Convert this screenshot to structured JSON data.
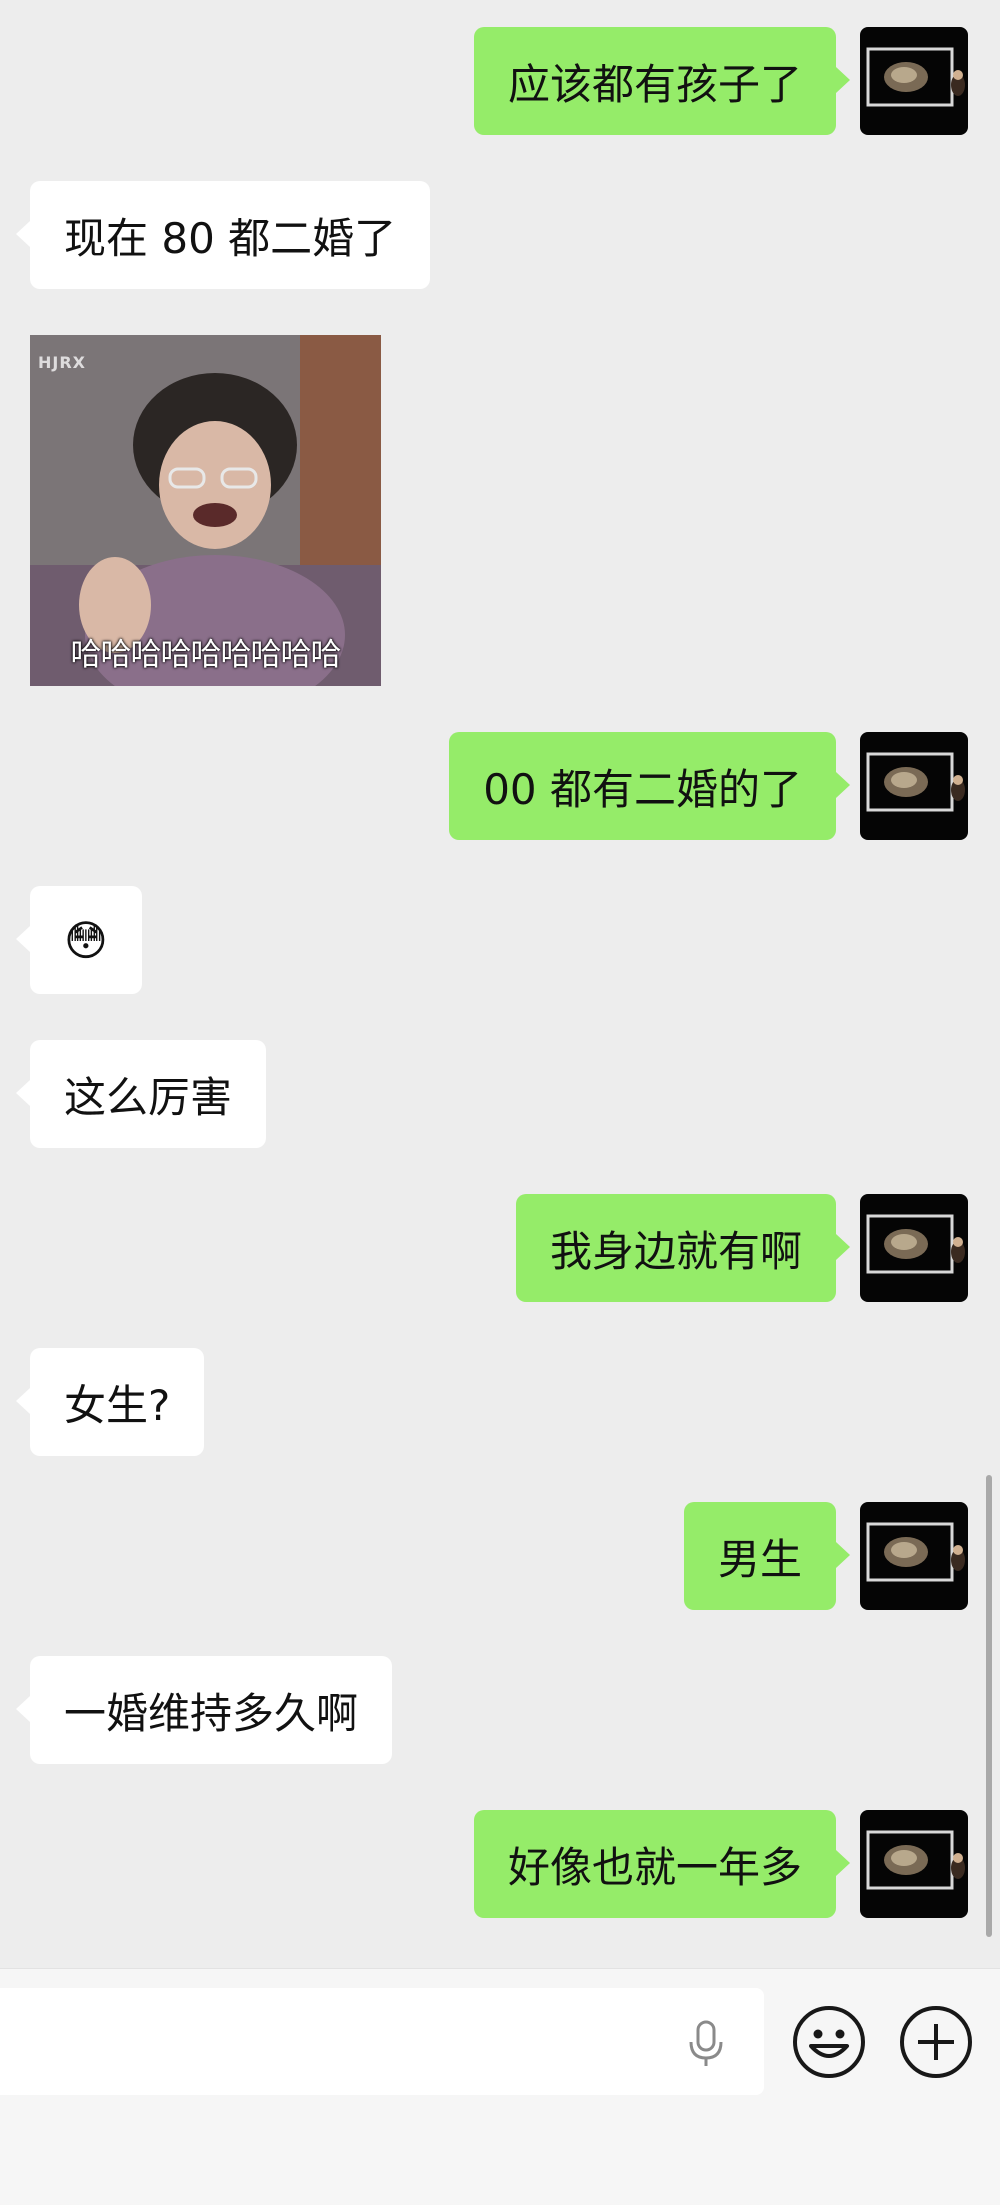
{
  "messages": [
    {
      "side": "out",
      "text": "应该都有孩子了"
    },
    {
      "side": "in",
      "text": "现在 80 都二婚了"
    },
    {
      "side": "in",
      "type": "sticker",
      "tag": "HJRX",
      "caption": "哈哈哈哈哈哈哈哈哈"
    },
    {
      "side": "out",
      "text": "00 都有二婚的了"
    },
    {
      "side": "in",
      "text": "😳"
    },
    {
      "side": "in",
      "text": "这么厉害"
    },
    {
      "side": "out",
      "text": "我身边就有啊"
    },
    {
      "side": "in",
      "text": "女生?"
    },
    {
      "side": "out",
      "text": "男生"
    },
    {
      "side": "in",
      "text": "一婚维持多久啊"
    },
    {
      "side": "out",
      "text": "好像也就一年多"
    }
  ],
  "avatar": {
    "icon": "framed-photo-avatar-icon"
  },
  "input_bar": {
    "voice_icon": "microphone-icon",
    "emoji_icon": "smiley-face-icon",
    "more_icon": "plus-circle-icon"
  },
  "colors": {
    "background": "#ededed",
    "outgoing_bubble": "#95ec69",
    "incoming_bubble": "#ffffff"
  }
}
